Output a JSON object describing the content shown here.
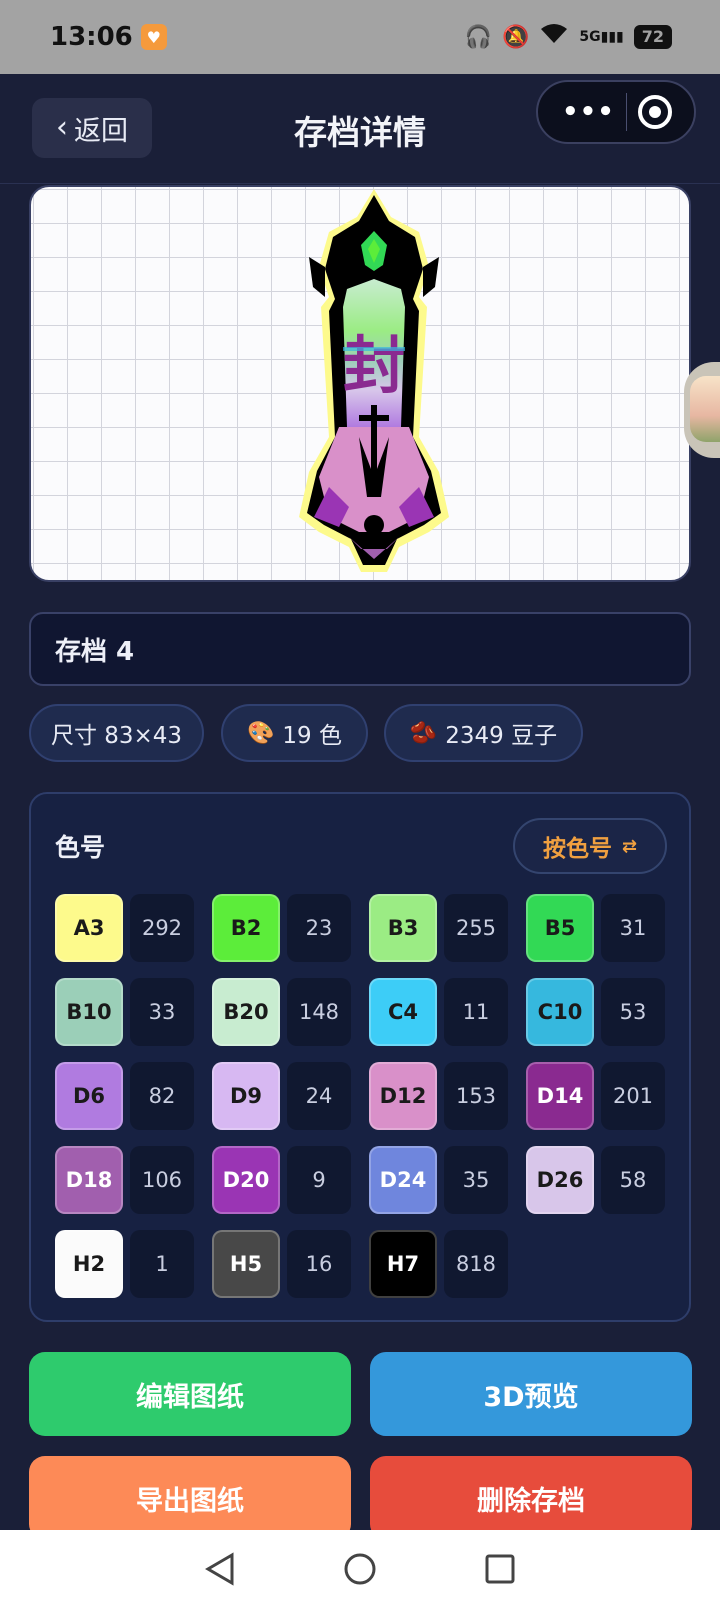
{
  "status_bar": {
    "time": "13:06",
    "battery": "72",
    "network": "5G"
  },
  "header": {
    "back_label": "返回",
    "title": "存档详情"
  },
  "save": {
    "name": "存档 4",
    "size": "尺寸 83×43",
    "colors": "19 色",
    "beads": "2349 豆子"
  },
  "palette": {
    "title": "色号",
    "sort_label": "按色号",
    "items": [
      {
        "code": "A3",
        "count": "292",
        "color": "#fdfa8c",
        "text": "#1a1a1a"
      },
      {
        "code": "B2",
        "count": "23",
        "color": "#5ced3a",
        "text": "#1a1a1a"
      },
      {
        "code": "B3",
        "count": "255",
        "color": "#9bec84",
        "text": "#1a1a1a"
      },
      {
        "code": "B5",
        "count": "31",
        "color": "#32d955",
        "text": "#1a1a1a"
      },
      {
        "code": "B10",
        "count": "33",
        "color": "#9bcfb8",
        "text": "#1a1a1a"
      },
      {
        "code": "B20",
        "count": "148",
        "color": "#c8ecd0",
        "text": "#1a1a1a"
      },
      {
        "code": "C4",
        "count": "11",
        "color": "#3dcdf7",
        "text": "#1a1a1a"
      },
      {
        "code": "C10",
        "count": "53",
        "color": "#36b8de",
        "text": "#1a1a1a"
      },
      {
        "code": "D6",
        "count": "82",
        "color": "#b07be0",
        "text": "#1a1a1a"
      },
      {
        "code": "D9",
        "count": "24",
        "color": "#d7b8f2",
        "text": "#1a1a1a"
      },
      {
        "code": "D12",
        "count": "153",
        "color": "#d990c9",
        "text": "#1a1a1a"
      },
      {
        "code": "D14",
        "count": "201",
        "color": "#8a2a90",
        "text": "#ffffff"
      },
      {
        "code": "D18",
        "count": "106",
        "color": "#a15fae",
        "text": "#ffffff"
      },
      {
        "code": "D20",
        "count": "9",
        "color": "#9a35b4",
        "text": "#ffffff"
      },
      {
        "code": "D24",
        "count": "35",
        "color": "#6f86dd",
        "text": "#ffffff"
      },
      {
        "code": "D26",
        "count": "58",
        "color": "#d8c6ea",
        "text": "#1a1a1a"
      },
      {
        "code": "H2",
        "count": "1",
        "color": "#fbfbfb",
        "text": "#1a1a1a"
      },
      {
        "code": "H5",
        "count": "16",
        "color": "#484848",
        "text": "#ffffff"
      },
      {
        "code": "H7",
        "count": "818",
        "color": "#000000",
        "text": "#ffffff"
      }
    ]
  },
  "actions": {
    "edit": "编辑图纸",
    "preview_3d": "3D预览",
    "export": "导出图纸",
    "delete": "删除存档"
  },
  "colors": {
    "edit": "#2ecb6d",
    "preview_3d": "#3498db",
    "export": "#fd8a57",
    "delete": "#e74c3c"
  }
}
